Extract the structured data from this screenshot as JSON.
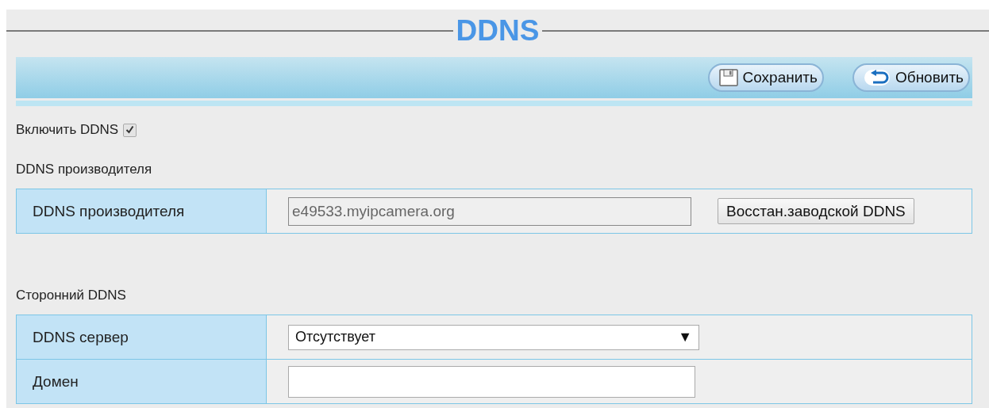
{
  "title": "DDNS",
  "toolbar": {
    "buttons": [
      {
        "kind": "save",
        "label": "Сохранить"
      },
      {
        "kind": "refresh",
        "label": "Обновить"
      }
    ]
  },
  "enable": {
    "label": "Включить DDNS",
    "checked": true
  },
  "sections": [
    {
      "heading": "DDNS производителя",
      "rows": [
        {
          "kind": "readonly",
          "label": "DDNS производителя",
          "value": "e49533.myipcamera.org",
          "button": "Восстан.заводской DDNS"
        }
      ]
    },
    {
      "heading": "Сторонний DDNS",
      "rows": [
        {
          "kind": "select",
          "label": "DDNS сервер",
          "value": "Отсутствует",
          "arrow": "▼"
        },
        {
          "kind": "input",
          "label": "Домен"
        }
      ]
    }
  ]
}
